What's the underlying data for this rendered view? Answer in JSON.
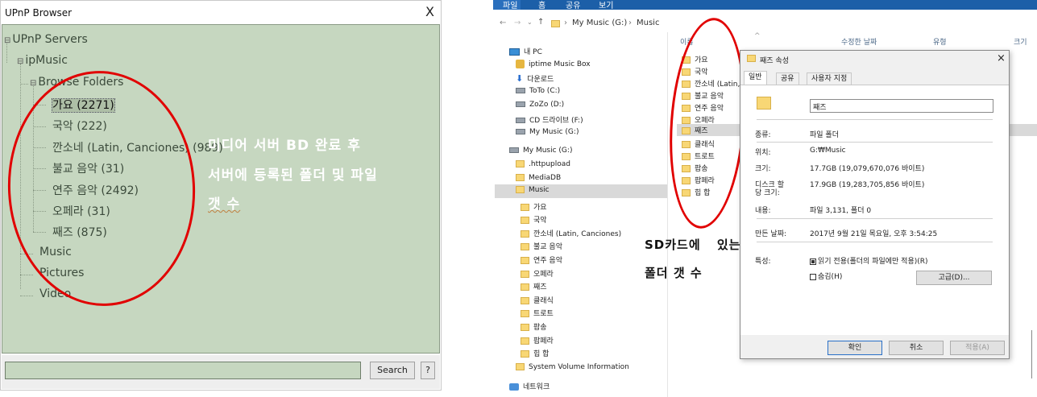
{
  "upnp": {
    "title": "UPnP Browser",
    "close_glyph": "X",
    "tree": {
      "root": "UPnP Servers",
      "server": "ipMusic",
      "browse_folders": "Browse Folders",
      "folders": [
        "가요 (2271)",
        "국악 (222)",
        "깐소네 (Latin, Canciones) (989)",
        "불교 음악 (31)",
        "연주 음악 (2492)",
        "오페라 (31)",
        "째즈 (875)"
      ],
      "music": "Music",
      "pictures": "Pictures",
      "video": "Video"
    },
    "search_button": "Search",
    "help_button": "?",
    "annotation": [
      "미디어 서버 BD 완료 후",
      "서버에 등록된 폴더 및 파일",
      "갯 수"
    ]
  },
  "explorer": {
    "ribbon_tabs": [
      "파일",
      "홈",
      "공유",
      "보기"
    ],
    "address": {
      "path": [
        "My Music (G:)",
        "Music"
      ]
    },
    "nav": {
      "this_pc": "내 PC",
      "items": [
        "iptime Music Box",
        "다운로드",
        "ToTo (C:)",
        "ZoZo (D:)",
        "CD 드라이브 (F:)",
        "My Music (G:)"
      ],
      "drive": "My Music (G:)",
      "drive_children": [
        ".httpupload",
        "MediaDB",
        "Music"
      ],
      "music_children": [
        "가요",
        "국악",
        "깐소네 (Latin, Canciones)",
        "불교 음악",
        "연주 음악",
        "오페라",
        "째즈",
        "클래식",
        "트로트",
        "팝송",
        "팝페라",
        "힙 합"
      ],
      "system": "System Volume Information",
      "network": "네트워크"
    },
    "columns": [
      "이름",
      "수정한 날짜",
      "유형",
      "크기"
    ],
    "files": [
      "가요",
      "국악",
      "깐소네 (Latin,",
      "불교 음악",
      "연주 음악",
      "오페라",
      "째즈",
      "클래식",
      "트로트",
      "팝송",
      "팝페라",
      "힙 합"
    ],
    "annotation": [
      "SD카드에 있는 음원",
      "폴더 갯 수"
    ]
  },
  "props": {
    "title": "째즈 속성",
    "close_glyph": "×",
    "tabs": [
      "일반",
      "공유",
      "사용자 지정"
    ],
    "name_value": "째즈",
    "rows": {
      "type_label": "종류:",
      "type_value": "파일 폴더",
      "loc_label": "위치:",
      "loc_value": "G:₩Music",
      "size_label": "크기:",
      "size_value": "17.7GB (19,079,670,076 바이트)",
      "disk_label_1": "디스크 할",
      "disk_label_2": "당 크기:",
      "disk_value": "17.9GB (19,283,705,856 바이트)",
      "content_label": "내용:",
      "content_value": "파일 3,131, 폴더 0",
      "created_label": "만든 날짜:",
      "created_value": "2017년 9월 21일 목요일, 오후 3:54:25",
      "attr_label": "특성:",
      "readonly_label": "읽기 전용(폴더의 파일에만 적용)(R)",
      "hidden_label": "숨김(H)",
      "advanced_button": "고급(D)..."
    },
    "ok": "확인",
    "cancel": "취소",
    "apply": "적용(A)"
  }
}
